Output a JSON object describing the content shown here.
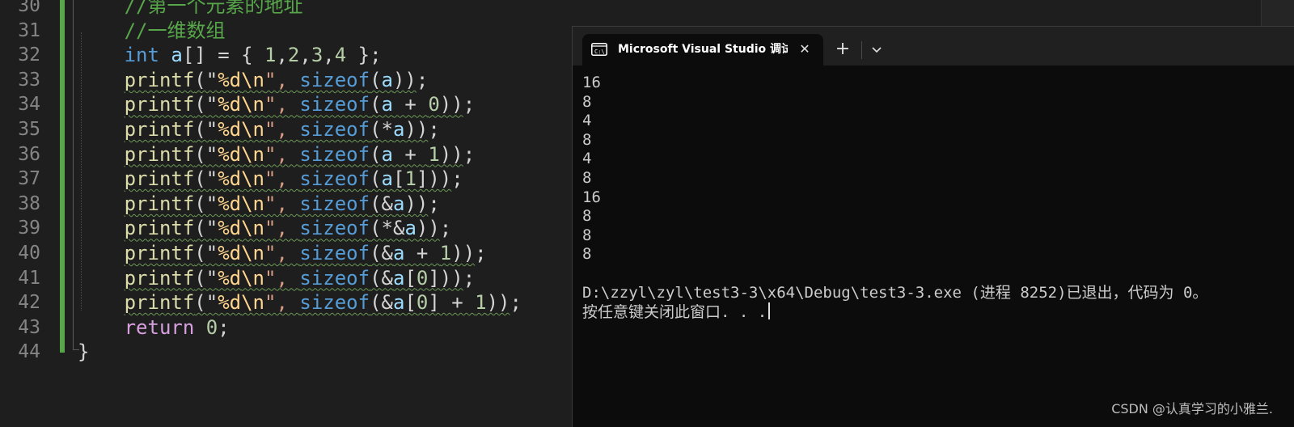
{
  "editor": {
    "lines": [
      {
        "num": "30",
        "parts": [
          {
            "t": "//第一个元素的地址",
            "c": "c-comment"
          }
        ]
      },
      {
        "num": "31",
        "parts": [
          {
            "t": "//一维数组",
            "c": "c-comment"
          }
        ]
      },
      {
        "num": "32",
        "parts": [
          {
            "t": "int",
            "c": "c-kw"
          },
          {
            "t": " ",
            "c": "c-pl"
          },
          {
            "t": "a",
            "c": "c-var"
          },
          {
            "t": "[] = { ",
            "c": "c-pl"
          },
          {
            "t": "1",
            "c": "c-num"
          },
          {
            "t": ",",
            "c": "c-pl"
          },
          {
            "t": "2",
            "c": "c-num"
          },
          {
            "t": ",",
            "c": "c-pl"
          },
          {
            "t": "3",
            "c": "c-num"
          },
          {
            "t": ",",
            "c": "c-pl"
          },
          {
            "t": "4",
            "c": "c-num"
          },
          {
            "t": " };",
            "c": "c-pl"
          }
        ]
      },
      {
        "num": "33",
        "parts": [
          {
            "t": "printf",
            "c": "c-fn squig"
          },
          {
            "t": "(\"",
            "c": "c-pl squig"
          },
          {
            "t": "%d",
            "c": "c-esc squig"
          },
          {
            "t": "\\n",
            "c": "c-esc squig"
          },
          {
            "t": "\", ",
            "c": "c-str squig"
          },
          {
            "t": "sizeof",
            "c": "c-kw squig"
          },
          {
            "t": "(",
            "c": "c-pl squig"
          },
          {
            "t": "a",
            "c": "c-var squig"
          },
          {
            "t": "))",
            "c": "c-pl squig"
          },
          {
            "t": ";",
            "c": "c-pl"
          }
        ]
      },
      {
        "num": "34",
        "parts": [
          {
            "t": "printf",
            "c": "c-fn squig"
          },
          {
            "t": "(\"",
            "c": "c-pl squig"
          },
          {
            "t": "%d",
            "c": "c-esc squig"
          },
          {
            "t": "\\n",
            "c": "c-esc squig"
          },
          {
            "t": "\", ",
            "c": "c-str squig"
          },
          {
            "t": "sizeof",
            "c": "c-kw squig"
          },
          {
            "t": "(",
            "c": "c-pl squig"
          },
          {
            "t": "a",
            "c": "c-var squig"
          },
          {
            "t": " + ",
            "c": "c-pl squig"
          },
          {
            "t": "0",
            "c": "c-num squig"
          },
          {
            "t": "))",
            "c": "c-pl squig"
          },
          {
            "t": ";",
            "c": "c-pl"
          }
        ]
      },
      {
        "num": "35",
        "parts": [
          {
            "t": "printf",
            "c": "c-fn squig"
          },
          {
            "t": "(\"",
            "c": "c-pl squig"
          },
          {
            "t": "%d",
            "c": "c-esc squig"
          },
          {
            "t": "\\n",
            "c": "c-esc squig"
          },
          {
            "t": "\", ",
            "c": "c-str squig"
          },
          {
            "t": "sizeof",
            "c": "c-kw squig"
          },
          {
            "t": "(*",
            "c": "c-pl squig"
          },
          {
            "t": "a",
            "c": "c-var squig"
          },
          {
            "t": "))",
            "c": "c-pl squig"
          },
          {
            "t": ";",
            "c": "c-pl"
          }
        ]
      },
      {
        "num": "36",
        "parts": [
          {
            "t": "printf",
            "c": "c-fn squig"
          },
          {
            "t": "(\"",
            "c": "c-pl squig"
          },
          {
            "t": "%d",
            "c": "c-esc squig"
          },
          {
            "t": "\\n",
            "c": "c-esc squig"
          },
          {
            "t": "\", ",
            "c": "c-str squig"
          },
          {
            "t": "sizeof",
            "c": "c-kw squig"
          },
          {
            "t": "(",
            "c": "c-pl squig"
          },
          {
            "t": "a",
            "c": "c-var squig"
          },
          {
            "t": " + ",
            "c": "c-pl squig"
          },
          {
            "t": "1",
            "c": "c-num squig"
          },
          {
            "t": "))",
            "c": "c-pl squig"
          },
          {
            "t": ";",
            "c": "c-pl"
          }
        ]
      },
      {
        "num": "37",
        "parts": [
          {
            "t": "printf",
            "c": "c-fn squig"
          },
          {
            "t": "(\"",
            "c": "c-pl squig"
          },
          {
            "t": "%d",
            "c": "c-esc squig"
          },
          {
            "t": "\\n",
            "c": "c-esc squig"
          },
          {
            "t": "\", ",
            "c": "c-str squig"
          },
          {
            "t": "sizeof",
            "c": "c-kw squig"
          },
          {
            "t": "(",
            "c": "c-pl squig"
          },
          {
            "t": "a",
            "c": "c-var squig"
          },
          {
            "t": "[",
            "c": "c-pl squig"
          },
          {
            "t": "1",
            "c": "c-num squig"
          },
          {
            "t": "]))",
            "c": "c-pl squig"
          },
          {
            "t": ";",
            "c": "c-pl"
          }
        ]
      },
      {
        "num": "38",
        "parts": [
          {
            "t": "printf",
            "c": "c-fn squig"
          },
          {
            "t": "(\"",
            "c": "c-pl squig"
          },
          {
            "t": "%d",
            "c": "c-esc squig"
          },
          {
            "t": "\\n",
            "c": "c-esc squig"
          },
          {
            "t": "\", ",
            "c": "c-str squig"
          },
          {
            "t": "sizeof",
            "c": "c-kw squig"
          },
          {
            "t": "(&",
            "c": "c-pl squig"
          },
          {
            "t": "a",
            "c": "c-var squig"
          },
          {
            "t": "))",
            "c": "c-pl squig"
          },
          {
            "t": ";",
            "c": "c-pl"
          }
        ]
      },
      {
        "num": "39",
        "parts": [
          {
            "t": "printf",
            "c": "c-fn squig"
          },
          {
            "t": "(\"",
            "c": "c-pl squig"
          },
          {
            "t": "%d",
            "c": "c-esc squig"
          },
          {
            "t": "\\n",
            "c": "c-esc squig"
          },
          {
            "t": "\", ",
            "c": "c-str squig"
          },
          {
            "t": "sizeof",
            "c": "c-kw squig"
          },
          {
            "t": "(*&",
            "c": "c-pl squig"
          },
          {
            "t": "a",
            "c": "c-var squig"
          },
          {
            "t": "))",
            "c": "c-pl squig"
          },
          {
            "t": ";",
            "c": "c-pl"
          }
        ]
      },
      {
        "num": "40",
        "parts": [
          {
            "t": "printf",
            "c": "c-fn squig"
          },
          {
            "t": "(\"",
            "c": "c-pl squig"
          },
          {
            "t": "%d",
            "c": "c-esc squig"
          },
          {
            "t": "\\n",
            "c": "c-esc squig"
          },
          {
            "t": "\", ",
            "c": "c-str squig"
          },
          {
            "t": "sizeof",
            "c": "c-kw squig"
          },
          {
            "t": "(&",
            "c": "c-pl squig"
          },
          {
            "t": "a",
            "c": "c-var squig"
          },
          {
            "t": " + ",
            "c": "c-pl squig"
          },
          {
            "t": "1",
            "c": "c-num squig"
          },
          {
            "t": "))",
            "c": "c-pl squig"
          },
          {
            "t": ";",
            "c": "c-pl"
          }
        ]
      },
      {
        "num": "41",
        "parts": [
          {
            "t": "printf",
            "c": "c-fn squig"
          },
          {
            "t": "(\"",
            "c": "c-pl squig"
          },
          {
            "t": "%d",
            "c": "c-esc squig"
          },
          {
            "t": "\\n",
            "c": "c-esc squig"
          },
          {
            "t": "\", ",
            "c": "c-str squig"
          },
          {
            "t": "sizeof",
            "c": "c-kw squig"
          },
          {
            "t": "(&",
            "c": "c-pl squig"
          },
          {
            "t": "a",
            "c": "c-var squig"
          },
          {
            "t": "[",
            "c": "c-pl squig"
          },
          {
            "t": "0",
            "c": "c-num squig"
          },
          {
            "t": "]))",
            "c": "c-pl squig"
          },
          {
            "t": ";",
            "c": "c-pl"
          }
        ]
      },
      {
        "num": "42",
        "parts": [
          {
            "t": "printf",
            "c": "c-fn squig"
          },
          {
            "t": "(\"",
            "c": "c-pl squig"
          },
          {
            "t": "%d",
            "c": "c-esc squig"
          },
          {
            "t": "\\n",
            "c": "c-esc squig"
          },
          {
            "t": "\", ",
            "c": "c-str squig"
          },
          {
            "t": "sizeof",
            "c": "c-kw squig"
          },
          {
            "t": "(&",
            "c": "c-pl squig"
          },
          {
            "t": "a",
            "c": "c-var squig"
          },
          {
            "t": "[",
            "c": "c-pl squig"
          },
          {
            "t": "0",
            "c": "c-num squig"
          },
          {
            "t": "] + ",
            "c": "c-pl squig"
          },
          {
            "t": "1",
            "c": "c-num squig"
          },
          {
            "t": "))",
            "c": "c-pl squig"
          },
          {
            "t": ";",
            "c": "c-pl"
          }
        ]
      },
      {
        "num": "43",
        "parts": [
          {
            "t": "return",
            "c": "c-kw2"
          },
          {
            "t": " ",
            "c": "c-pl"
          },
          {
            "t": "0",
            "c": "c-num"
          },
          {
            "t": ";",
            "c": "c-pl"
          }
        ]
      },
      {
        "num": "44",
        "parts": [
          {
            "t": "}",
            "c": "c-pl"
          }
        ]
      }
    ]
  },
  "console": {
    "tab_title": "Microsoft Visual Studio 调试控制台",
    "close_glyph": "✕",
    "add_glyph": "+",
    "output": [
      "16",
      "8",
      "4",
      "8",
      "4",
      "8",
      "16",
      "8",
      "8",
      "8",
      ""
    ],
    "exit_line": "D:\\zzyl\\zyl\\test3-3\\x64\\Debug\\test3-3.exe (进程 8252)已退出，代码为 0。",
    "press_key_line": "按任意键关闭此窗口. . ."
  },
  "watermark": "CSDN @认真学习的小雅兰."
}
